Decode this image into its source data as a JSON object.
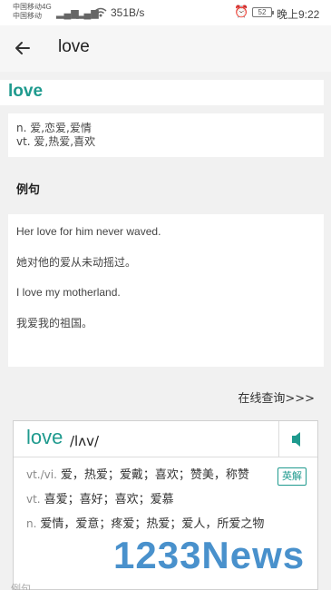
{
  "status_bar": {
    "carrier1": "中国移动4G",
    "carrier2": "中国移动",
    "net_speed": "351B/s",
    "battery": "52",
    "time": "晚上9:22"
  },
  "app_bar": {
    "title": "love"
  },
  "word": {
    "headword": "love",
    "definitions": [
      "n. 爱,恋爱,爱情",
      "vt. 爱,热爱,喜欢"
    ]
  },
  "examples": {
    "section_title": "例句",
    "items": [
      "Her love for him never waved.",
      "她对他的爱从未动摇过。",
      "I love my motherland.",
      "我爱我的祖国。"
    ],
    "online_query_label": "在线查询>>>"
  },
  "dict_popup": {
    "word": "love",
    "phonetic": "/lʌv/",
    "en_explain_label": "英解",
    "senses": [
      {
        "pos": "vt./vi.",
        "text": "爱，热爱；爱戴；喜欢；赞美，称赞"
      },
      {
        "pos": "vt.",
        "text": "喜爱；喜好；喜欢；爱慕"
      },
      {
        "pos": "n.",
        "text": "爱情，爱意；疼爱；热爱；爱人，所爱之物"
      }
    ]
  },
  "watermark": "1233News",
  "bottom_partial": "例句",
  "colors": {
    "accent": "#1f9a8e",
    "background": "#f1f1f1"
  }
}
